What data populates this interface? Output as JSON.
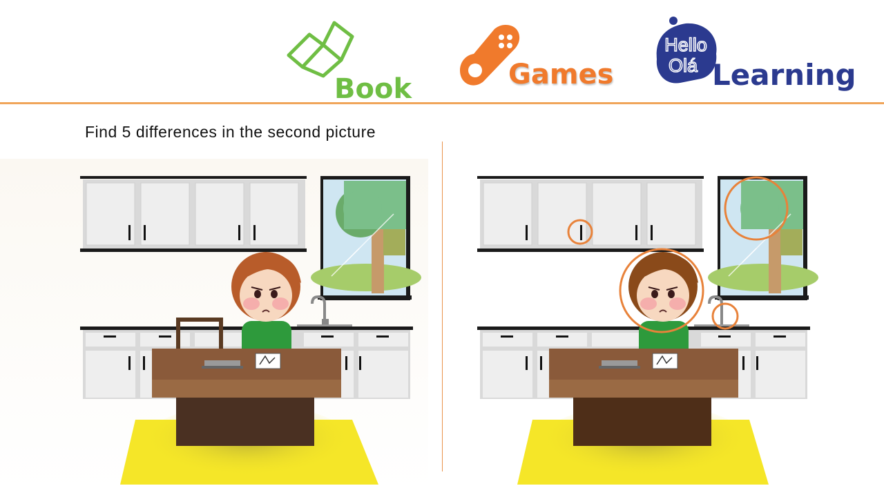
{
  "header": {
    "nav": [
      {
        "label": "Book",
        "icon": "open-book-icon",
        "color": "#6fbe44"
      },
      {
        "label": "Games",
        "icon": "gamepad-icon",
        "color": "#f07a2c"
      },
      {
        "label": "Learning",
        "icon": "hello-ola-bubble-icon",
        "color": "#2b3a8f",
        "bubble_line1": "Hello",
        "bubble_line2": "Olá"
      }
    ],
    "rule_color": "#f0a55a"
  },
  "instruction": "Find 5 differences in the second picture",
  "puzzle": {
    "difference_count": 5,
    "marker_color": "#e8823a",
    "scene_colors": {
      "cabinet": "#eeeeee",
      "countertop": "#1a1a1a",
      "table": "#8a5a3a",
      "rug": "#f5e628",
      "shirt": "#2e9a3c",
      "hair_left": "#b85c2a",
      "hair_right": "#8a4a1a",
      "tree_leaves": "#7bbf8a",
      "tree_trunk": "#c69a6a"
    }
  }
}
